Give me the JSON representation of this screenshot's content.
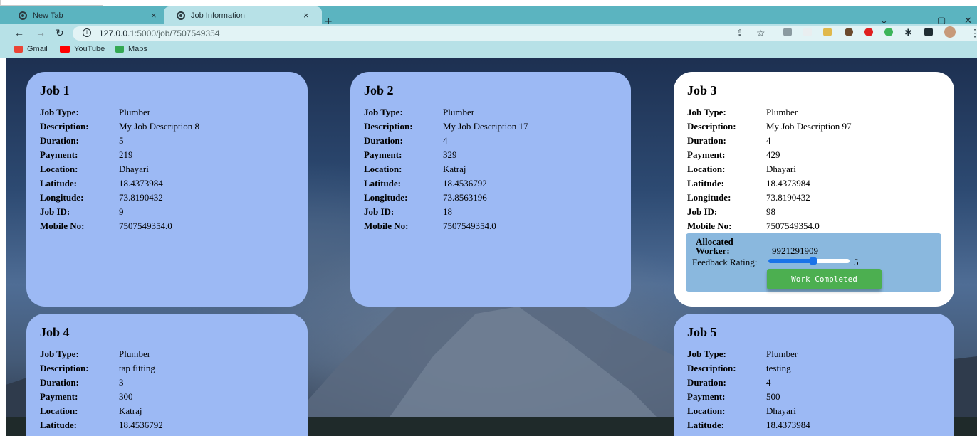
{
  "browser": {
    "tabs": [
      {
        "label": "New Tab",
        "close": "×"
      },
      {
        "label": "Job Information",
        "close": "×"
      }
    ],
    "new_tab": "+",
    "window_controls": {
      "minimize": "—",
      "restore": "▢",
      "close": "✕",
      "tab_list": "⌄"
    },
    "url_host": "127.0.0.1",
    "url_path": ":5000/job/7507549354",
    "bookmarks": [
      "Gmail",
      "YouTube",
      "Maps"
    ]
  },
  "labels": {
    "job_type": "Job Type:",
    "description": "Description:",
    "duration": "Duration:",
    "payment": "Payment:",
    "location": "Location:",
    "latitude": "Latitude:",
    "longitude": "Longitude:",
    "job_id": "Job ID:",
    "mobile": "Mobile No:"
  },
  "jobs": [
    {
      "title": "Job 1",
      "job_type": "Plumber",
      "description": "My Job Description 8",
      "duration": "5",
      "payment": "219",
      "location": "Dhayari",
      "latitude": "18.4373984",
      "longitude": "73.8190432",
      "job_id": "9",
      "mobile": "7507549354.0"
    },
    {
      "title": "Job 2",
      "job_type": "Plumber",
      "description": "My Job Description 17",
      "duration": "4",
      "payment": "329",
      "location": "Katraj",
      "latitude": "18.4536792",
      "longitude": "73.8563196",
      "job_id": "18",
      "mobile": "7507549354.0"
    },
    {
      "title": "Job 3",
      "job_type": "Plumber",
      "description": "My Job Description 97",
      "duration": "4",
      "payment": "429",
      "location": "Dhayari",
      "latitude": "18.4373984",
      "longitude": "73.8190432",
      "job_id": "98",
      "mobile": "7507549354.0"
    },
    {
      "title": "Job 4",
      "job_type": "Plumber",
      "description": "tap fitting",
      "duration": "3",
      "payment": "300",
      "location": "Katraj",
      "latitude": "18.4536792"
    },
    {
      "title": "Job 5",
      "job_type": "Plumber",
      "description": "testing",
      "duration": "4",
      "payment": "500",
      "location": "Dhayari",
      "latitude": "18.4373984"
    }
  ],
  "allocation": {
    "label": "Allocated Worker:",
    "worker": "9921291909",
    "feedback_label": "Feedback Rating:",
    "rating": "5",
    "rating_fraction": 0.55,
    "button": "Work Completed"
  },
  "colors": {
    "card": "#9cb9f4",
    "active_card": "#ffffff",
    "alloc_panel": "#8ab8de",
    "button": "#4caf50",
    "tab_strip": "#5bb4c0"
  }
}
